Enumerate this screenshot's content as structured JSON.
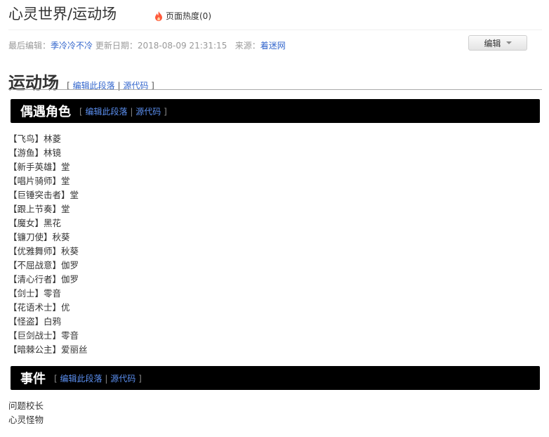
{
  "header": {
    "title": "心灵世界/运动场",
    "heat_label": "页面热度(0)"
  },
  "meta": {
    "last_edit_label": "最后编辑：",
    "editor": "季冷冷不冷",
    "update_label": "更新日期：",
    "update_time": "2018-08-09 21:31:15",
    "source_label": "来源：",
    "source": "着迷网"
  },
  "toolbar": {
    "edit_label": "编辑"
  },
  "section": {
    "title": "运动场",
    "open_bracket": "[",
    "edit_link": "编辑此段落",
    "sep": "|",
    "source_link": "源代码",
    "close_bracket": "]"
  },
  "characters_block": {
    "title": "偶遇角色",
    "open_bracket": "[",
    "edit_link": "编辑此段落",
    "sep": "|",
    "source_link": "源代码",
    "close_bracket": "]",
    "items": [
      "【飞鸟】林菱",
      "【游鱼】林镜",
      "【新手英雄】堂",
      "【唱片骑师】堂",
      "【巨锤突击者】堂",
      "【跟上节奏】堂",
      "【魔女】黑花",
      "【镰刀使】秋葵",
      "【优雅舞师】秋葵",
      "【不屈战意】伽罗",
      "【清心行者】伽罗",
      "【剑士】零音",
      "【花语术士】优",
      "【怪盗】白鸦",
      "【巨剑战士】零音",
      "【暗棘公主】爱丽丝"
    ]
  },
  "events_block": {
    "title": "事件",
    "open_bracket": "[",
    "edit_link": "编辑此段落",
    "sep": "|",
    "source_link": "源代码",
    "close_bracket": "]",
    "items": [
      "问题校长",
      "心灵怪物"
    ]
  }
}
